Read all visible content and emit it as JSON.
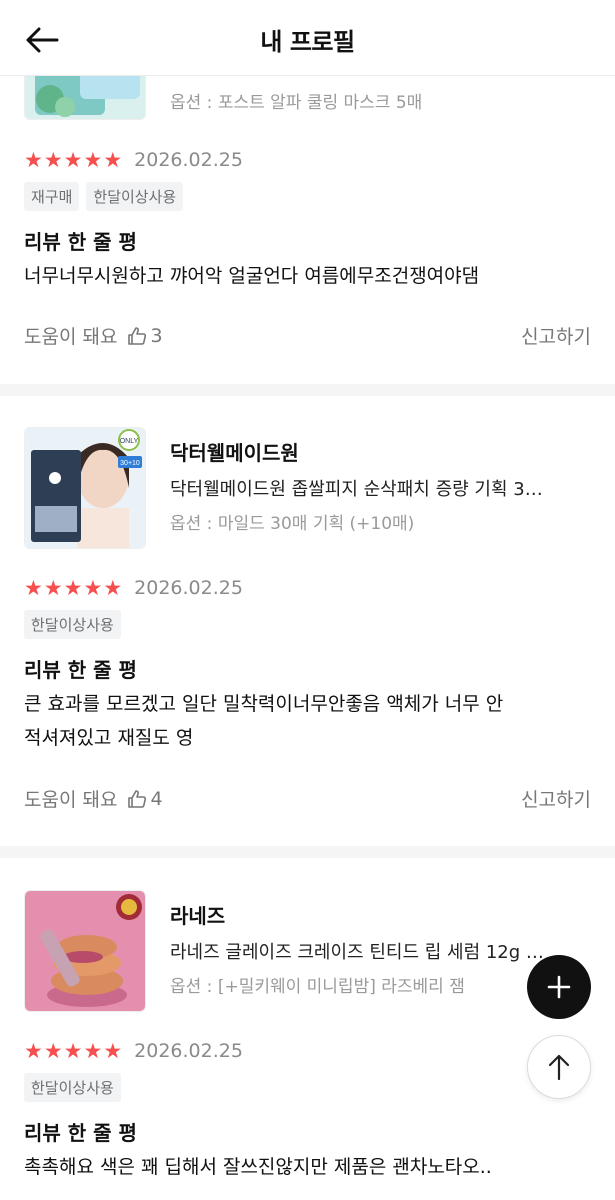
{
  "header": {
    "title": "내 프로필"
  },
  "reviews": [
    {
      "option": "옵션 : 포스트 알파 쿨링 마스크 5매",
      "date": "2026.02.25",
      "tags": [
        "재구매",
        "한달이상사용"
      ],
      "one_line_label": "리뷰 한 줄 평",
      "text": "너무너무시원하고 꺄어악 얼굴언다 여름에무조건쟁여야댐",
      "helpful_label": "도움이 돼요",
      "helpful_count": "3",
      "report_label": "신고하기"
    },
    {
      "brand": "닥터웰메이드원",
      "name": "닥터웰메이드원 좁쌀피지 순삭패치 증량 기획 3…",
      "option": "옵션 : 마일드 30매 기획 (+10매)",
      "thumb_badge": "ONLY",
      "thumb_count": "30+10",
      "date": "2026.02.25",
      "tags": [
        "한달이상사용"
      ],
      "one_line_label": "리뷰 한 줄 평",
      "text_line1": "큰 효과를 모르겠고 일단 밀착력이너무안좋음 액체가 너무 안",
      "text_line2": "적셔져있고 재질도 영",
      "helpful_label": "도움이 돼요",
      "helpful_count": "4",
      "report_label": "신고하기"
    },
    {
      "brand": "라네즈",
      "name": "라네즈 글레이즈 크레이즈 틴티드 립 세럼 12g …",
      "option": "옵션 : [+밀키웨이 미니립밤] 라즈베리 잼",
      "date": "2026.02.25",
      "tags": [
        "한달이상사용"
      ],
      "one_line_label": "리뷰 한 줄 평",
      "text": "촉촉해요 색은 꽤 딥해서 잘쓰진않지만 제품은 괜차노타오.."
    }
  ],
  "colors": {
    "star": "#f5504f",
    "fab": "#111111",
    "tag_bg": "#f2f3f5"
  },
  "icons": {
    "back": "arrow-left-icon",
    "thumbs_up": "thumbs-up-icon",
    "add": "plus-icon",
    "scroll_top": "arrow-up-icon"
  }
}
